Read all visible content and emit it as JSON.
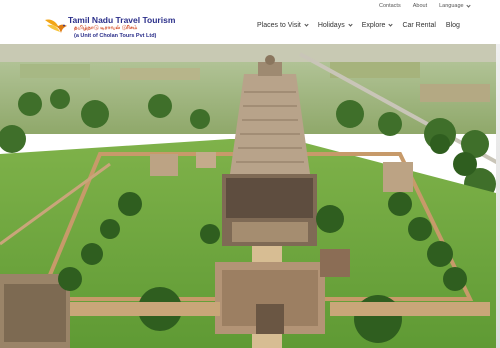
{
  "brand": {
    "title": "Tamil Nadu Travel Tourism",
    "tamil": "தமிழ்நாடு டிராவல் டூரிசம்",
    "subtitle": "(a Unit of Cholan Tours Pvt Ltd)"
  },
  "topbar": {
    "contacts": "Contacts",
    "about": "About",
    "language": "Language"
  },
  "nav": {
    "places": "Places to Visit",
    "holidays": "Holidays",
    "explore": "Explore",
    "car_rental": "Car Rental",
    "blog": "Blog"
  },
  "colors": {
    "brand_blue": "#2b2f8a",
    "brand_orange": "#d2451e",
    "logo_gold": "#f2a516"
  },
  "icons": {
    "logo": "bird-logo-icon",
    "dropdown": "chevron-down-icon"
  }
}
